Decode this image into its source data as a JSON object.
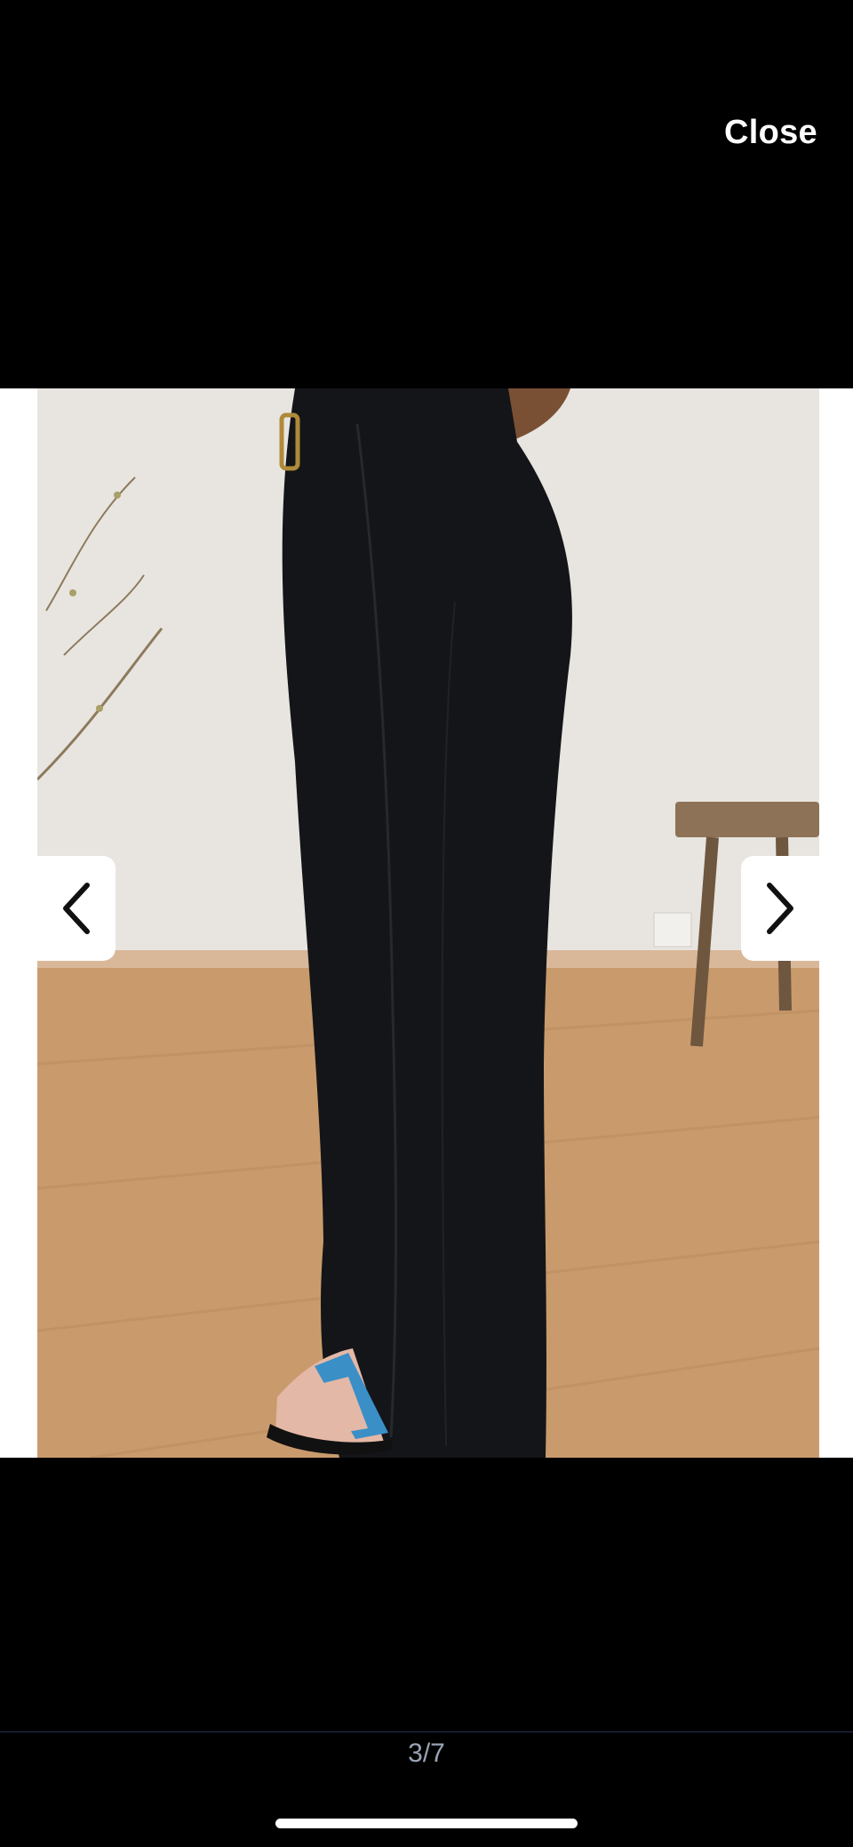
{
  "viewer": {
    "close_label": "Close",
    "page_counter": "3/7",
    "current_page": 3,
    "total_pages": 7
  },
  "icons": {
    "prev": "chevron-left-icon",
    "next": "chevron-right-icon"
  },
  "colors": {
    "background": "#000000",
    "text": "#ffffff",
    "counter_text": "#9aa3b5",
    "nav_button_bg": "#ffffff"
  }
}
